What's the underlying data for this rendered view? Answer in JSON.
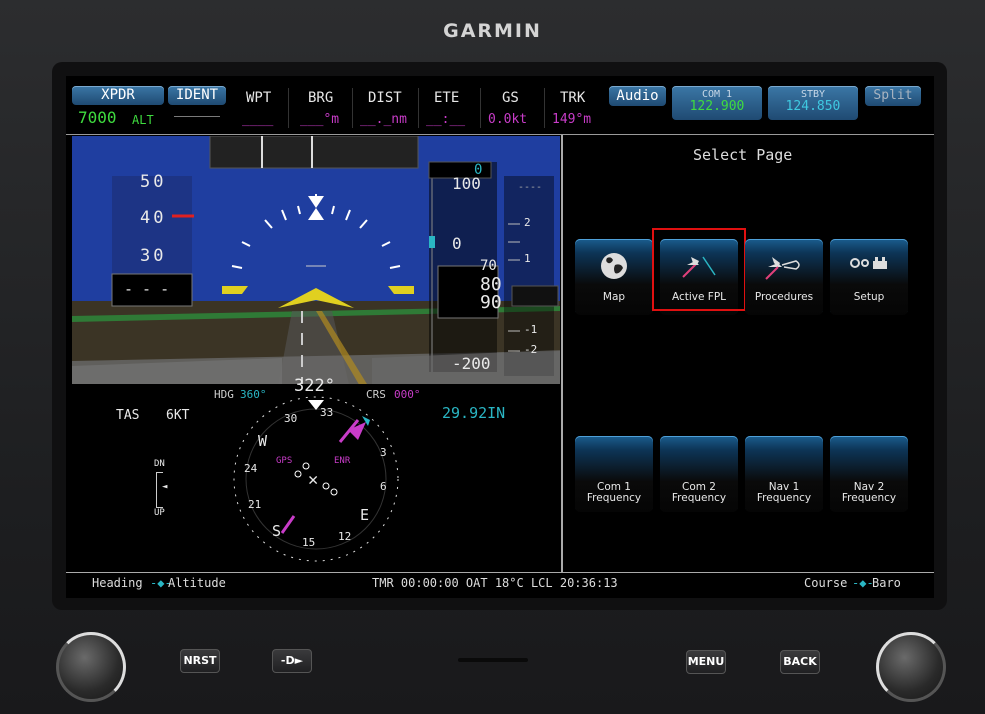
{
  "brand": "GARMIN",
  "topbar": {
    "xpdr_label": "XPDR",
    "xpdr_code": "7000",
    "xpdr_mode": "ALT",
    "ident_label": "IDENT",
    "fields": [
      {
        "label": "WPT",
        "value": "____"
      },
      {
        "label": "BRG",
        "value": "___°m"
      },
      {
        "label": "DIST",
        "value": "__._nm"
      },
      {
        "label": "ETE",
        "value": "__:__"
      },
      {
        "label": "GS",
        "value": "0.0kt"
      },
      {
        "label": "TRK",
        "value": "149°m"
      }
    ],
    "audio_label": "Audio",
    "com1_label": "COM 1",
    "com1_freq": "122.900",
    "stby_label": "STBY",
    "stby_freq": "124.850",
    "split_label": "Split"
  },
  "pfd": {
    "speed_ticks": [
      "50",
      "40",
      "30"
    ],
    "speed_readout": "- - -",
    "alt_ticks": [
      "100",
      "0",
      "-200"
    ],
    "alt_readout": [
      "80",
      "90"
    ],
    "alt_readout_top": "70",
    "alt_bug": "0",
    "vs_ticks": [
      "2",
      "1",
      "-1",
      "-2"
    ],
    "vs_top": "----",
    "tas_label": "TAS",
    "tas_value": "6KT",
    "hdg_label": "HDG",
    "hdg_value": "360°",
    "crs_label": "CRS",
    "crs_value": "000°",
    "heading": "322°",
    "baro": "29.92IN",
    "compass_marks": [
      "33",
      "30",
      "W",
      "24",
      "21",
      "S",
      "15",
      "12",
      "E",
      "6",
      "3"
    ],
    "gps_label": "GPS",
    "enr_label": "ENR",
    "flaps_dn": "DN",
    "flaps_up": "UP"
  },
  "mfd": {
    "title": "Select Page",
    "buttons": [
      {
        "label": "Map",
        "icon": "globe-icon"
      },
      {
        "label": "Active FPL",
        "icon": "active-fpl-icon"
      },
      {
        "label": "Procedures",
        "icon": "procedures-icon"
      },
      {
        "label": "Setup",
        "icon": "gears-icon"
      }
    ],
    "freq_buttons": [
      {
        "line1": "Com 1",
        "line2": "Frequency"
      },
      {
        "line1": "Com 2",
        "line2": "Frequency"
      },
      {
        "line1": "Nav 1",
        "line2": "Frequency"
      },
      {
        "line1": "Nav 2",
        "line2": "Frequency"
      }
    ],
    "highlight_color": "#e01010"
  },
  "bottombar": {
    "left_a": "Heading",
    "left_b": "Altitude",
    "center": "TMR 00:00:00 OAT 18°C LCL 20:36:13",
    "right_a": "Course",
    "right_b": "Baro"
  },
  "hardware": {
    "nrst": "NRST",
    "direct": "-D►",
    "menu": "MENU",
    "back": "BACK"
  }
}
